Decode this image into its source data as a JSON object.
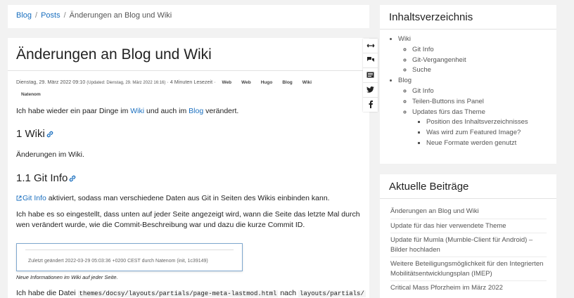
{
  "breadcrumb": {
    "items": [
      "Blog",
      "Posts"
    ],
    "current": "Änderungen an Blog und Wiki",
    "sep": "/"
  },
  "article": {
    "title": "Änderungen an Blog und Wiki",
    "meta": {
      "date": "Dienstag, 29. März 2022 09:10",
      "updated": "(Updated: Dienstag, 29. März 2022 16:16)",
      "reading": "· 4 Minuten Lesezeit ·",
      "tags": [
        "Web",
        "Web",
        "Hugo",
        "Blog",
        "Wiki",
        "Natenom"
      ]
    },
    "intro": {
      "pre": "Ich habe wieder ein paar Dinge im ",
      "link1": "Wiki",
      "mid": " und auch im ",
      "link2": "Blog",
      "post": " verändert."
    },
    "h_wiki": "1 Wiki",
    "p_wiki": "Änderungen im Wiki.",
    "h_gitinfo": "1.1 Git Info",
    "p_gitinfo": {
      "link": "Git Info",
      "text": " aktiviert, sodass man verschiedene Daten aus Git in Seiten des Wikis einbinden kann."
    },
    "p_lastmod": "Ich habe es so eingestellt, dass unten auf jeder Seite angezeigt wird, wann die Seite das letzte Mal durch wen verändert wurde, wie die Commit-Beschreibung war und dazu die kurze Commit ID.",
    "shot_text": "Zuletzt geändert 2022-03-29 05:03:36 +0200 CEST durch Natenom (init, 1c39149)",
    "caption": "Neue Informationen im Wiki auf jeder Seite.",
    "p_file": {
      "pre": "Ich habe die Datei ",
      "code1": "themes/docsy/layouts/partials/page-meta-lastmod.html",
      "mid": " nach ",
      "code2": "layouts/partials/"
    }
  },
  "share": {
    "icons": [
      "expand-icon",
      "comments-icon",
      "article-icon",
      "twitter-icon",
      "facebook-icon"
    ]
  },
  "toc": {
    "title": "Inhaltsverzeichnis",
    "wiki": "Wiki",
    "wiki_children": [
      "Git Info",
      "Git-Vergangenheit",
      "Suche"
    ],
    "blog": "Blog",
    "blog_children": [
      "Git Info",
      "Teilen-Buttons ins Panel",
      "Updates fürs das Theme"
    ],
    "theme_children": [
      "Position des Inhaltsverzeichnisses",
      "Was wird zum Featured Image?",
      "Neue Formate werden genutzt"
    ]
  },
  "recent": {
    "title": "Aktuelle Beiträge",
    "items": [
      "Änderungen an Blog und Wiki",
      "Update für das hier verwendete Theme",
      "Update für Mumla (Mumble-Client für Android) – Bilder hochladen",
      "Weitere Beteiligungsmöglichkeit für den Integrierten Mobilitätsentwicklungsplan (IMEP)",
      "Critical Mass Pforzheim im März 2022"
    ]
  },
  "colors": {
    "link": "#1a6fbf",
    "background": "#f2f2f2",
    "card": "#ffffff"
  }
}
